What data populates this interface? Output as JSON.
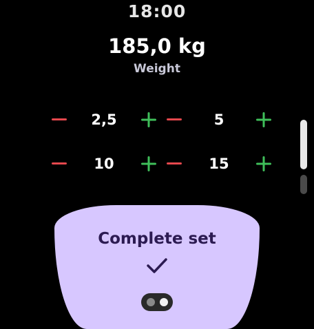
{
  "status_bar": {
    "time": "18:00"
  },
  "header": {
    "weight_value": "185,0 kg",
    "weight_label": "Weight"
  },
  "increments": [
    {
      "value": "2,5",
      "minus_icon": "minus-icon",
      "plus_icon": "plus-icon"
    },
    {
      "value": "5",
      "minus_icon": "minus-icon",
      "plus_icon": "plus-icon"
    },
    {
      "value": "10",
      "minus_icon": "minus-icon",
      "plus_icon": "plus-icon"
    },
    {
      "value": "15",
      "minus_icon": "minus-icon",
      "plus_icon": "plus-icon"
    }
  ],
  "action": {
    "label": "Complete set",
    "icon": "check-icon"
  },
  "pager": {
    "pages": 2,
    "active_page": 1
  },
  "colors": {
    "background": "#000000",
    "minus": "#e5484d",
    "plus": "#3fbf5a",
    "button_bg": "#d7c7ff",
    "button_text": "#2c1b52"
  }
}
